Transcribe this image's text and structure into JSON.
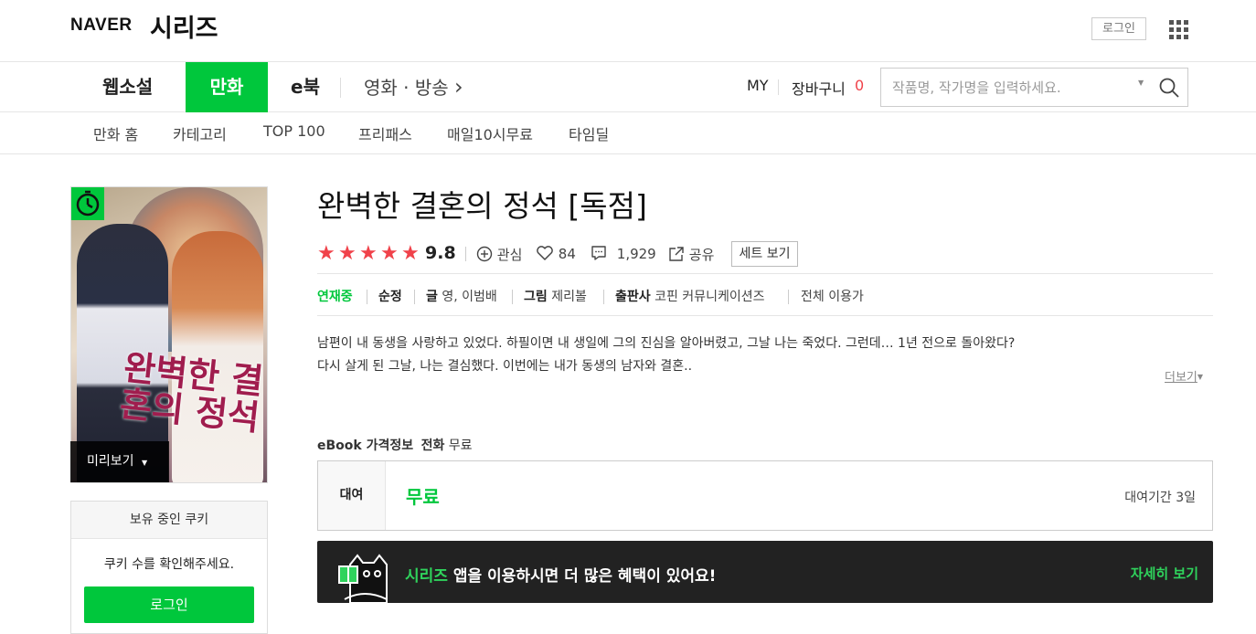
{
  "header": {
    "logo_naver": "NAVER",
    "logo_series": "시리즈",
    "login": "로그인",
    "apps_icon": "grid-icon"
  },
  "main_nav": {
    "items": [
      "웹소설",
      "만화",
      "e북",
      "영화 · 방송"
    ],
    "active": "만화",
    "movie_chevron": "›",
    "my": "MY",
    "cart": "장바구니",
    "cart_count": "0",
    "search_placeholder": "작품명, 작가명을 입력하세요."
  },
  "sub_nav": {
    "items": [
      "만화 홈",
      "카테고리",
      "TOP 100",
      "프리패스",
      "매일10시무료",
      "타임딜"
    ]
  },
  "cover": {
    "title_art": "완벽한 결혼의 정석",
    "badge_icon": "clock-icon",
    "preview": "미리보기"
  },
  "cookie": {
    "header": "보유 중인 쿠키",
    "message": "쿠키 수를 확인해주세요.",
    "login": "로그인"
  },
  "book": {
    "title": "완벽한 결혼의 정석 [독점]",
    "stars": "★★★★★",
    "rating": "9.8",
    "interest": "관심",
    "likes": "84",
    "comments": "1,929",
    "share": "공유",
    "set_view": "세트 보기",
    "status": "연재중",
    "genre": "순정",
    "writer_label": "글",
    "writer": "영, 이범배",
    "artist_label": "그림",
    "artist": "제리볼",
    "publisher_label": "출판사",
    "publisher": "코핀 커뮤니케이션즈",
    "age": "전체 이용가",
    "description_line1": "남편이 내 동생을 사랑하고 있었다. 하필이면 내 생일에 그의 진심을 알아버렸고, 그날 나는 죽었다. 그런데… 1년 전으로 돌아왔다?",
    "description_line2": "다시 살게 된 그날, 나는 결심했다. 이번에는 내가 동생의 남자와 결혼..",
    "more": "더보기"
  },
  "price": {
    "header_label": "eBook 가격정보",
    "header_scope": "전화",
    "header_value": "무료",
    "rent_label": "대여",
    "rent_price": "무료",
    "rent_period": "대여기간 3일"
  },
  "banner": {
    "brand": "시리즈",
    "text": " 앱을 이용하시면 더 많은 혜택이 있어요!",
    "link": "자세히 보기"
  },
  "colors": {
    "accent": "#00c73c",
    "star": "#f0424a",
    "banner_bg": "#222222"
  }
}
